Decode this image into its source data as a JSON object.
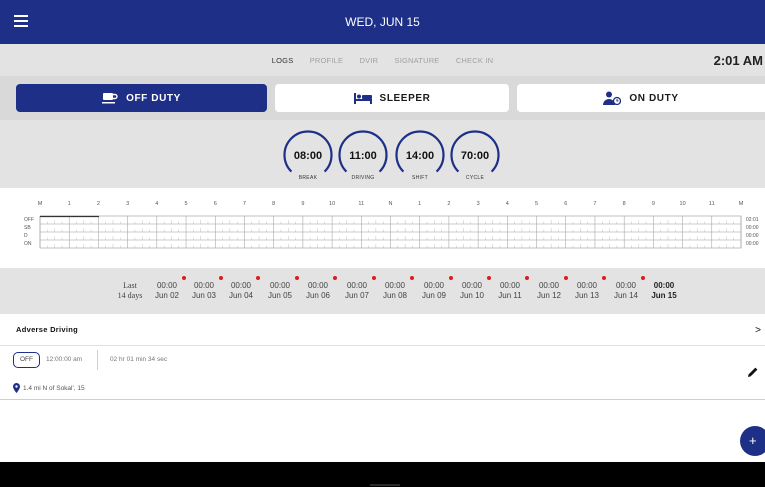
{
  "header": {
    "title": "WED, JUN 15",
    "menu_icon": "menu-icon",
    "theme_icon": "moon-icon"
  },
  "tabs": [
    {
      "label": "LOGS",
      "active": true
    },
    {
      "label": "PROFILE",
      "active": false
    },
    {
      "label": "DVIR",
      "active": false
    },
    {
      "label": "SIGNATURE",
      "active": false
    },
    {
      "label": "CHECK IN",
      "active": false
    }
  ],
  "clock": "2:01 AM",
  "duty_status": {
    "off_duty": {
      "label": "OFF DUTY",
      "active": true
    },
    "sleeper": {
      "label": "SLEEPER",
      "active": false
    },
    "on_duty": {
      "label": "ON DUTY",
      "active": false
    }
  },
  "timers": [
    {
      "value": "08:00",
      "label": "BREAK"
    },
    {
      "value": "11:00",
      "label": "DRIVING"
    },
    {
      "value": "14:00",
      "label": "SHIFT"
    },
    {
      "value": "70:00",
      "label": "CYCLE"
    }
  ],
  "log_grid": {
    "hours": [
      "M",
      "1",
      "2",
      "3",
      "4",
      "5",
      "6",
      "7",
      "8",
      "9",
      "10",
      "11",
      "N",
      "1",
      "2",
      "3",
      "4",
      "5",
      "6",
      "7",
      "8",
      "9",
      "10",
      "11",
      "M"
    ],
    "rows": [
      {
        "label": "OFF",
        "total": "02:01"
      },
      {
        "label": "SB",
        "total": "00:00"
      },
      {
        "label": "D",
        "total": "00:00"
      },
      {
        "label": "ON",
        "total": "00:00"
      }
    ],
    "off_duty_hours": 2.02
  },
  "summary": {
    "last_label": "Last",
    "period_label": "14 days",
    "days": [
      {
        "hours": "00:00",
        "date": "Jun 02",
        "flag": true
      },
      {
        "hours": "00:00",
        "date": "Jun 03",
        "flag": true
      },
      {
        "hours": "00:00",
        "date": "Jun 04",
        "flag": true
      },
      {
        "hours": "00:00",
        "date": "Jun 05",
        "flag": true
      },
      {
        "hours": "00:00",
        "date": "Jun 06",
        "flag": true
      },
      {
        "hours": "00:00",
        "date": "Jun 07",
        "flag": true
      },
      {
        "hours": "00:00",
        "date": "Jun 08",
        "flag": true
      },
      {
        "hours": "00:00",
        "date": "Jun 09",
        "flag": true
      },
      {
        "hours": "00:00",
        "date": "Jun 10",
        "flag": true
      },
      {
        "hours": "00:00",
        "date": "Jun 11",
        "flag": true
      },
      {
        "hours": "00:00",
        "date": "Jun 12",
        "flag": true
      },
      {
        "hours": "00:00",
        "date": "Jun 13",
        "flag": true
      },
      {
        "hours": "00:00",
        "date": "Jun 14",
        "flag": true
      },
      {
        "hours": "00:00",
        "date": "Jun 15",
        "flag": false
      }
    ]
  },
  "adverse_driving": {
    "label": "Adverse Driving",
    "chevron": ">"
  },
  "event": {
    "status": "OFF",
    "time": "12:00:00 am",
    "duration": "02 hr 01 min 34 sec",
    "location": "1.4 mi N of Sokal', 15"
  },
  "fab_label": "+",
  "colors": {
    "primary": "#1e2f87",
    "panel": "#e3e3e3",
    "alert": "#e01b1b"
  }
}
